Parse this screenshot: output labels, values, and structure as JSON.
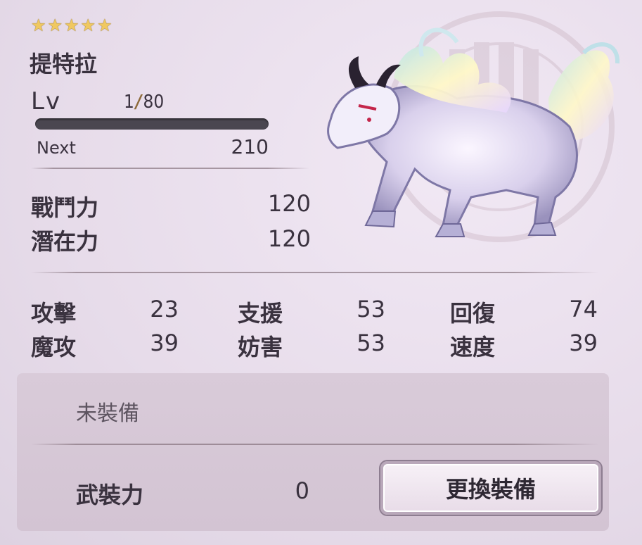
{
  "rarity": {
    "stars": 5
  },
  "character": {
    "name": "提特拉",
    "level_label": "Lv",
    "level": "1",
    "level_max": "80",
    "exp_progress": 0.0,
    "next_label": "Next",
    "next_value": "210"
  },
  "power": {
    "combat_label": "戰鬥力",
    "combat_value": "120",
    "potential_label": "潛在力",
    "potential_value": "120"
  },
  "stats": [
    {
      "label": "攻擊",
      "value": "23"
    },
    {
      "label": "支援",
      "value": "53"
    },
    {
      "label": "回復",
      "value": "74"
    },
    {
      "label": "魔攻",
      "value": "39"
    },
    {
      "label": "妨害",
      "value": "53"
    },
    {
      "label": "速度",
      "value": "39"
    }
  ],
  "equipment": {
    "status": "未裝備",
    "armament_label": "武裝力",
    "armament_value": "0",
    "change_button": "更換裝備"
  },
  "colors": {
    "star": "#f0c860",
    "exp_bar": "#4a4650",
    "panel": "#d9cbd9"
  },
  "icons": {
    "creature": "spirit-beast-illustration",
    "background_emblem": "crest-emblem"
  }
}
